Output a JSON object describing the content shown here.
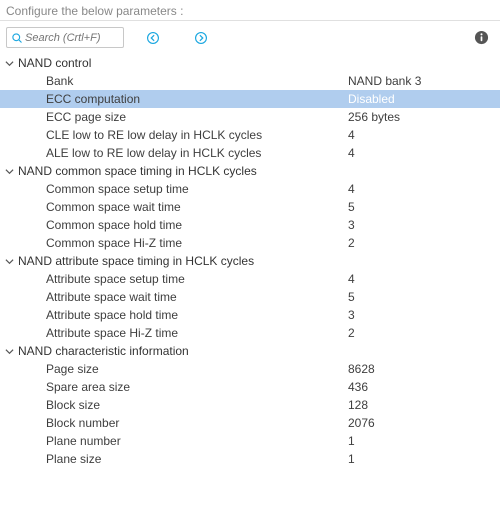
{
  "header": {
    "title": "Configure the below parameters :"
  },
  "search": {
    "placeholder": "Search (Crtl+F)"
  },
  "groups": [
    {
      "label": "NAND control",
      "items": [
        {
          "param": "Bank",
          "value": "NAND bank 3",
          "selected": false
        },
        {
          "param": "ECC computation",
          "value": "Disabled",
          "selected": true
        },
        {
          "param": "ECC page size",
          "value": "256 bytes",
          "selected": false
        },
        {
          "param": "CLE low to RE low delay in HCLK cycles",
          "value": "4",
          "selected": false
        },
        {
          "param": "ALE low to RE low delay in HCLK cycles",
          "value": "4",
          "selected": false
        }
      ]
    },
    {
      "label": "NAND common space timing in HCLK cycles",
      "items": [
        {
          "param": "Common space setup time",
          "value": "4",
          "selected": false
        },
        {
          "param": "Common space wait time",
          "value": "5",
          "selected": false
        },
        {
          "param": "Common space hold time",
          "value": "3",
          "selected": false
        },
        {
          "param": "Common space Hi-Z time",
          "value": "2",
          "selected": false
        }
      ]
    },
    {
      "label": "NAND attribute space timing in HCLK cycles",
      "items": [
        {
          "param": "Attribute space setup time",
          "value": "4",
          "selected": false
        },
        {
          "param": "Attribute space wait time",
          "value": "5",
          "selected": false
        },
        {
          "param": "Attribute space hold time",
          "value": "3",
          "selected": false
        },
        {
          "param": "Attribute space Hi-Z time",
          "value": "2",
          "selected": false
        }
      ]
    },
    {
      "label": "NAND characteristic information",
      "items": [
        {
          "param": "Page size",
          "value": "8628",
          "selected": false
        },
        {
          "param": "Spare area size",
          "value": "436",
          "selected": false
        },
        {
          "param": "Block size",
          "value": "128",
          "selected": false
        },
        {
          "param": "Block number",
          "value": "2076",
          "selected": false
        },
        {
          "param": "Plane number",
          "value": "1",
          "selected": false
        },
        {
          "param": "Plane size",
          "value": "1",
          "selected": false
        }
      ]
    }
  ]
}
